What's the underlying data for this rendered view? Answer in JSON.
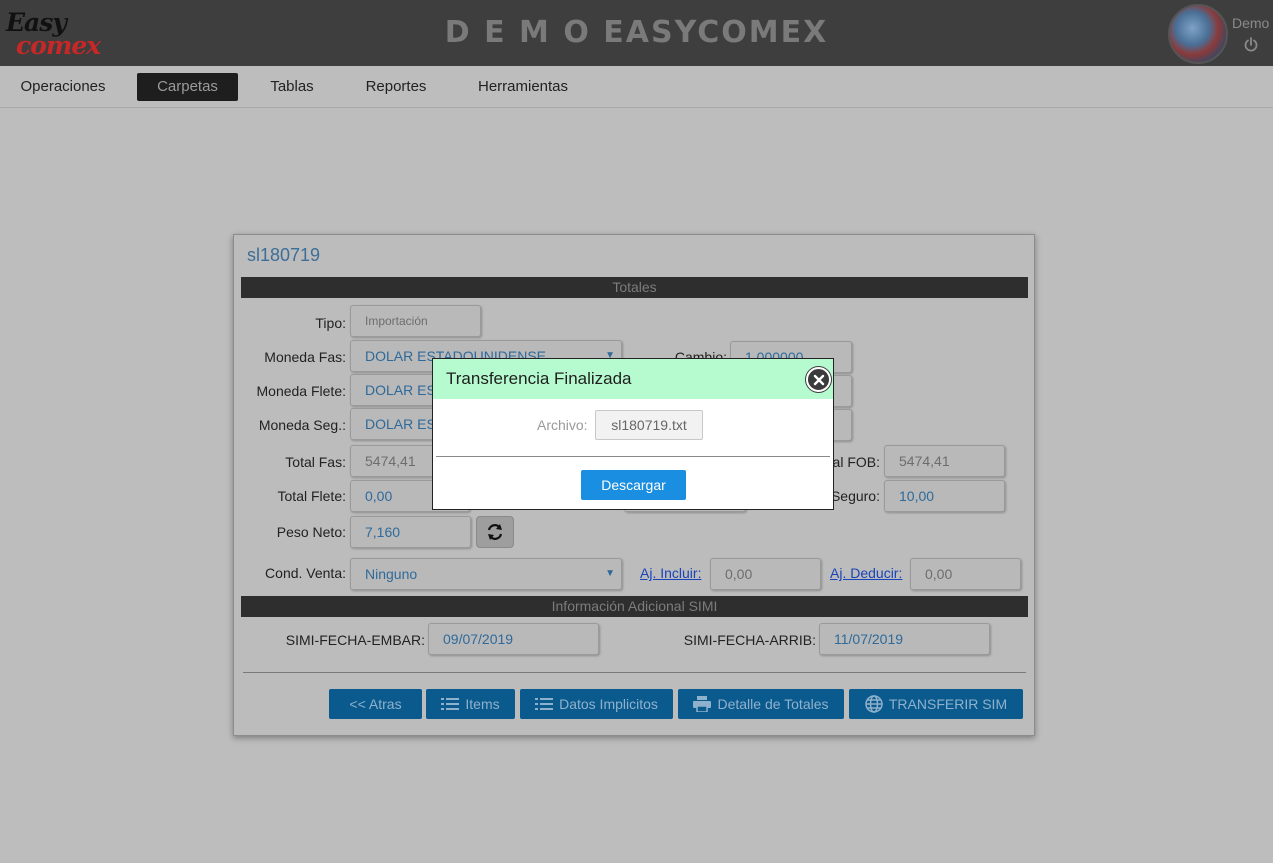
{
  "header": {
    "logo_line1": "Easy",
    "logo_line2": "comex",
    "title": "D E M O EASYCOMEX",
    "user_name": "Demo"
  },
  "menu": {
    "items": [
      {
        "label": "Operaciones"
      },
      {
        "label": "Carpetas",
        "active": true
      },
      {
        "label": "Tablas"
      },
      {
        "label": "Reportes"
      },
      {
        "label": "Herramientas"
      }
    ]
  },
  "panel": {
    "title": "sl180719",
    "section_totales": "Totales",
    "section_simi": "Información Adicional SIMI",
    "labels": {
      "tipo": "Tipo:",
      "moneda_fas": "Moneda Fas:",
      "moneda_flete": "Moneda Flete:",
      "moneda_seg": "Moneda Seg.:",
      "total_fas": "Total Fas:",
      "total_flete": "Total Flete:",
      "peso_neto": "Peso Neto:",
      "cond_venta": "Cond. Venta:",
      "cambio": "Cambio:",
      "total_fob": "al FOB:",
      "seguro": "Seguro:",
      "aj_incluir": "Aj. Incluir:",
      "aj_deducir": "Aj. Deducir:",
      "simi_fecha_embar": "SIMI-FECHA-EMBAR:",
      "simi_fecha_arrib": "SIMI-FECHA-ARRIB:"
    },
    "values": {
      "tipo": "Importación",
      "moneda_fas": "DOLAR ESTADOUNIDENSE",
      "moneda_flete": "DOLAR ES",
      "moneda_seg": "DOLAR ES",
      "total_fas": "5474,41",
      "total_flete": "0,00",
      "peso_neto": "7,160",
      "cond_venta": "Ninguno",
      "cambio": "1,000000",
      "total_fob": "5474,41",
      "seguro": "10,00",
      "aj_incluir": "0,00",
      "aj_deducir": "0,00",
      "simi_fecha_embar": "09/07/2019",
      "simi_fecha_arrib": "11/07/2019"
    },
    "buttons": {
      "atras": "<< Atras",
      "items": "Items",
      "datos_implicitos": "Datos Implicitos",
      "detalle_totales": "Detalle de Totales",
      "transferir_sim": "TRANSFERIR SIM"
    }
  },
  "modal": {
    "title": "Transferencia Finalizada",
    "archivo_label": "Archivo:",
    "archivo_value": "sl180719.txt",
    "download_label": "Descargar"
  },
  "colors": {
    "modal_header": "#b6fbcf",
    "primary_button": "#1a8ee0",
    "section_bar": "#2e2e2e",
    "field_text": "#2f6a9a"
  },
  "icons": [
    "power-icon",
    "refresh-icon",
    "list-icon",
    "print-icon",
    "globe-icon",
    "close-icon",
    "dropdown-caret-icon"
  ]
}
